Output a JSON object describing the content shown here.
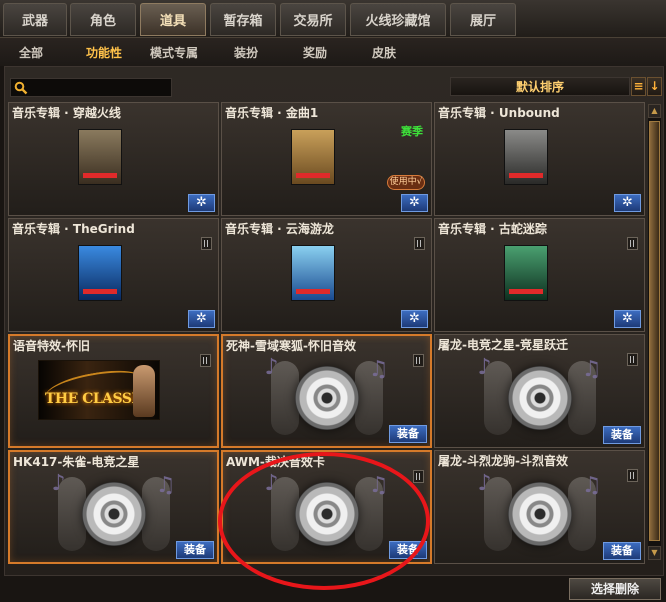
{
  "top_tabs": [
    "武器",
    "角色",
    "道具",
    "暂存箱",
    "交易所",
    "火线珍藏馆",
    "展厅"
  ],
  "active_top_tab": "道具",
  "sub_tabs": [
    "全部",
    "功能性",
    "模式专属",
    "装扮",
    "奖励",
    "皮肤"
  ],
  "active_sub_tab": "功能性",
  "search": {
    "placeholder": ""
  },
  "sort": {
    "label": "默认排序",
    "menu_icon": "≡",
    "order_icon": "↓"
  },
  "items": [
    {
      "title": "音乐专辑 · 穿越火线",
      "type": "album",
      "action": "gear",
      "cover": "#6b5a3e"
    },
    {
      "title": "音乐专辑 · 金曲1",
      "type": "album",
      "action": "gear",
      "badge": "赛季",
      "status": "使用中√",
      "cover": "#a07a3e"
    },
    {
      "title": "音乐专辑 · Unbound",
      "type": "album",
      "action": "gear",
      "cover": "#5a5a58"
    },
    {
      "title": "音乐专辑 · TheGrind",
      "type": "album",
      "action": "gear",
      "trash": true,
      "cover": "#2a6ab0"
    },
    {
      "title": "音乐专辑 · 云海游龙",
      "type": "album",
      "action": "gear",
      "trash": true,
      "cover": "#3a8ad0"
    },
    {
      "title": "音乐专辑 · 古蛇迷踪",
      "type": "album",
      "action": "gear",
      "trash": true,
      "cover": "#2e6a4a"
    },
    {
      "title": "语音特效-怀旧",
      "type": "classic",
      "trash": true,
      "selected": true,
      "art_text": "THE CLASSIC"
    },
    {
      "title": "死神-雪域寒狐-怀旧音效",
      "type": "disc",
      "action": "equip",
      "trash": true,
      "selected": true
    },
    {
      "title": "屠龙-电竞之星-竞星跃迁",
      "type": "disc",
      "action": "equip",
      "trash": true
    },
    {
      "title": "HK417-朱雀-电竞之星",
      "type": "disc",
      "action": "equip",
      "selected": true
    },
    {
      "title": "AWM-裁决音效卡",
      "type": "disc",
      "action": "equip",
      "trash": true,
      "selected": true
    },
    {
      "title": "屠龙-斗烈龙驹-斗烈音效",
      "type": "disc",
      "action": "equip",
      "trash": true
    }
  ],
  "labels": {
    "equip": "装备",
    "gear": "✲",
    "bulk_delete": "选择删除"
  },
  "scroll_arrows": {
    "up": "▲",
    "down": "▼"
  }
}
